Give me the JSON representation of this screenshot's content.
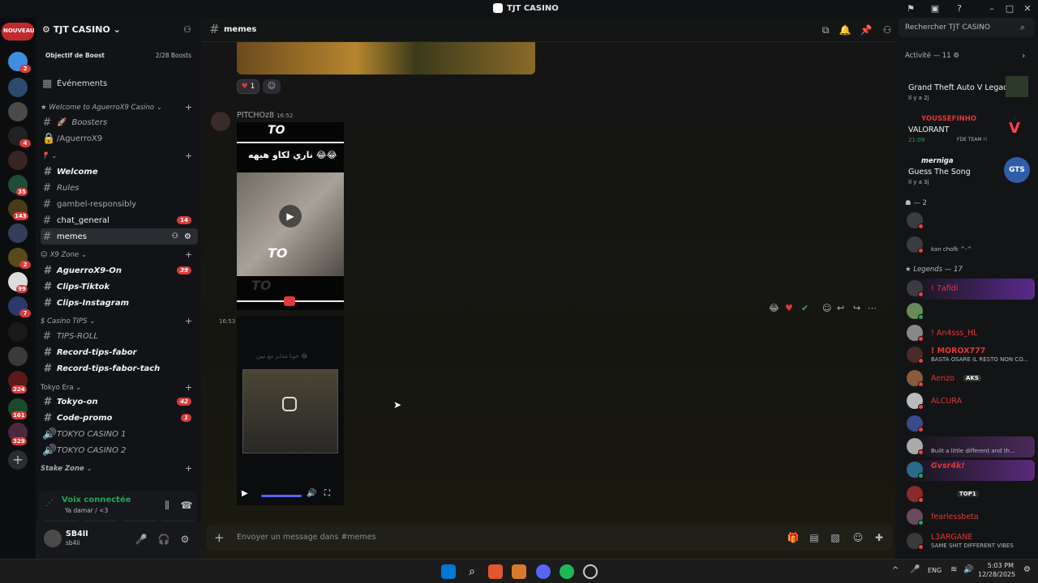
{
  "window": {
    "title": "TJT CASINO",
    "app_icon": "discord-icon"
  },
  "guilds": {
    "new_label": "NOUVEAU",
    "badges": [
      "2",
      "4",
      "35",
      "143",
      "2",
      "99",
      "7",
      "224",
      "161",
      "329"
    ]
  },
  "server": {
    "name": "TJT CASINO",
    "boost_goal": "Objectif de Boost",
    "boost_count": "2/28 Boosts",
    "events": "Événements",
    "categories": {
      "welcome": "Welcome to AguerroX9 Casino",
      "pin": "",
      "x9zone": "X9 Zone",
      "casino_tips": "Casino TIPS",
      "tokyo_era": "Tokyo Era",
      "stake_zone": "Stake Zone"
    },
    "channels": {
      "boosters": "Boosters",
      "aguerro": "/AguerroX9",
      "welcome": "Welcome",
      "rules": "Rules",
      "gambel": "gambel-responsibly",
      "chat_general": "chat_general",
      "chat_general_badge": "14",
      "memes": "memes",
      "aguerro_on": "AguerroX9-On",
      "aguerro_on_badge": "39",
      "clips_tiktok": "Clips-Tiktok",
      "clips_instagram": "Clips-Instagram",
      "tips_roll": "TIPS-ROLL",
      "record_fabor": "Record-tips-fabor",
      "record_fabor_tach": "Record-tips-fabor-tach",
      "tokyo_on": "Tokyo-on",
      "tokyo_on_badge": "42",
      "code_promo": "Code-promo",
      "code_promo_badge": "1",
      "tokyo_casino1": "TOKYO CASINO 1",
      "tokyo_casino2": "TOKYO CASINO 2"
    }
  },
  "voice": {
    "status": "Voix connectée",
    "location": "Ya damar / <3"
  },
  "user": {
    "name": "SB4II",
    "tag": "sb4ii"
  },
  "chat": {
    "channel": "memes",
    "search_placeholder": "Rechercher TJT CASINO",
    "reaction_count": "1",
    "message_author": "PITCHOz8",
    "message_time": "16:52",
    "second_time": "16:53",
    "video_text_to": "TO",
    "video_arabic": "ناري لكاو هيهه 😂😂",
    "video2_arabic": "خونا مدابز مع تبين 😂",
    "composer_placeholder": "Envoyer un message dans #memes"
  },
  "members": {
    "activity_header": "Activité — 11",
    "activities": [
      {
        "name": "",
        "game": "Grand Theft Auto V Legacy",
        "time": "Il y a 2j",
        "name_color": "#e0383b"
      },
      {
        "name": "YOUSSEFINHO",
        "game": "VALORANT",
        "time": "21:09",
        "extra": "FDE TEAM !!",
        "name_color": "#e0383b"
      },
      {
        "name": "merniga",
        "game": "Guess The Song",
        "time": "Il y a 3j",
        "name_color": "#dbdee1"
      }
    ],
    "group2_header": "— 2",
    "group2": [
      {
        "name": "",
        "status": ""
      },
      {
        "name": "",
        "status": "kan chofk ^-^"
      }
    ],
    "legends_header": "Legends — 17",
    "legends": [
      {
        "name": "! 7afidi",
        "status": "",
        "color": "#e0383b"
      },
      {
        "name": "",
        "status": "",
        "color": "#e0383b"
      },
      {
        "name": "! An4sss_HL",
        "status": "",
        "color": "#e0383b"
      },
      {
        "name": "! MOROX777",
        "status": "BASTA OSARE IL RESTO NON CO...",
        "color": "#e0383b"
      },
      {
        "name": "Aenzo",
        "status": "",
        "tag": "AKS",
        "color": "#e0383b"
      },
      {
        "name": "ALCURA",
        "status": "",
        "color": "#e0383b"
      },
      {
        "name": "",
        "status": "",
        "color": "#e0383b"
      },
      {
        "name": "",
        "status": "Built a little different and th...",
        "color": "#e0383b"
      },
      {
        "name": "Gvsr4k!",
        "status": "",
        "color": "#e0383b"
      },
      {
        "name": "",
        "status": "",
        "tag": "TOP1",
        "color": "#e0383b"
      },
      {
        "name": "fearlessbeta",
        "status": "",
        "color": "#e0383b"
      },
      {
        "name": "L3ARGANE",
        "status": "SAME SHIT DIFFERENT VIBES",
        "color": "#e0383b"
      }
    ]
  },
  "taskbar": {
    "lang": "ENG",
    "time": "5:03 PM",
    "date": "12/28/2025"
  }
}
